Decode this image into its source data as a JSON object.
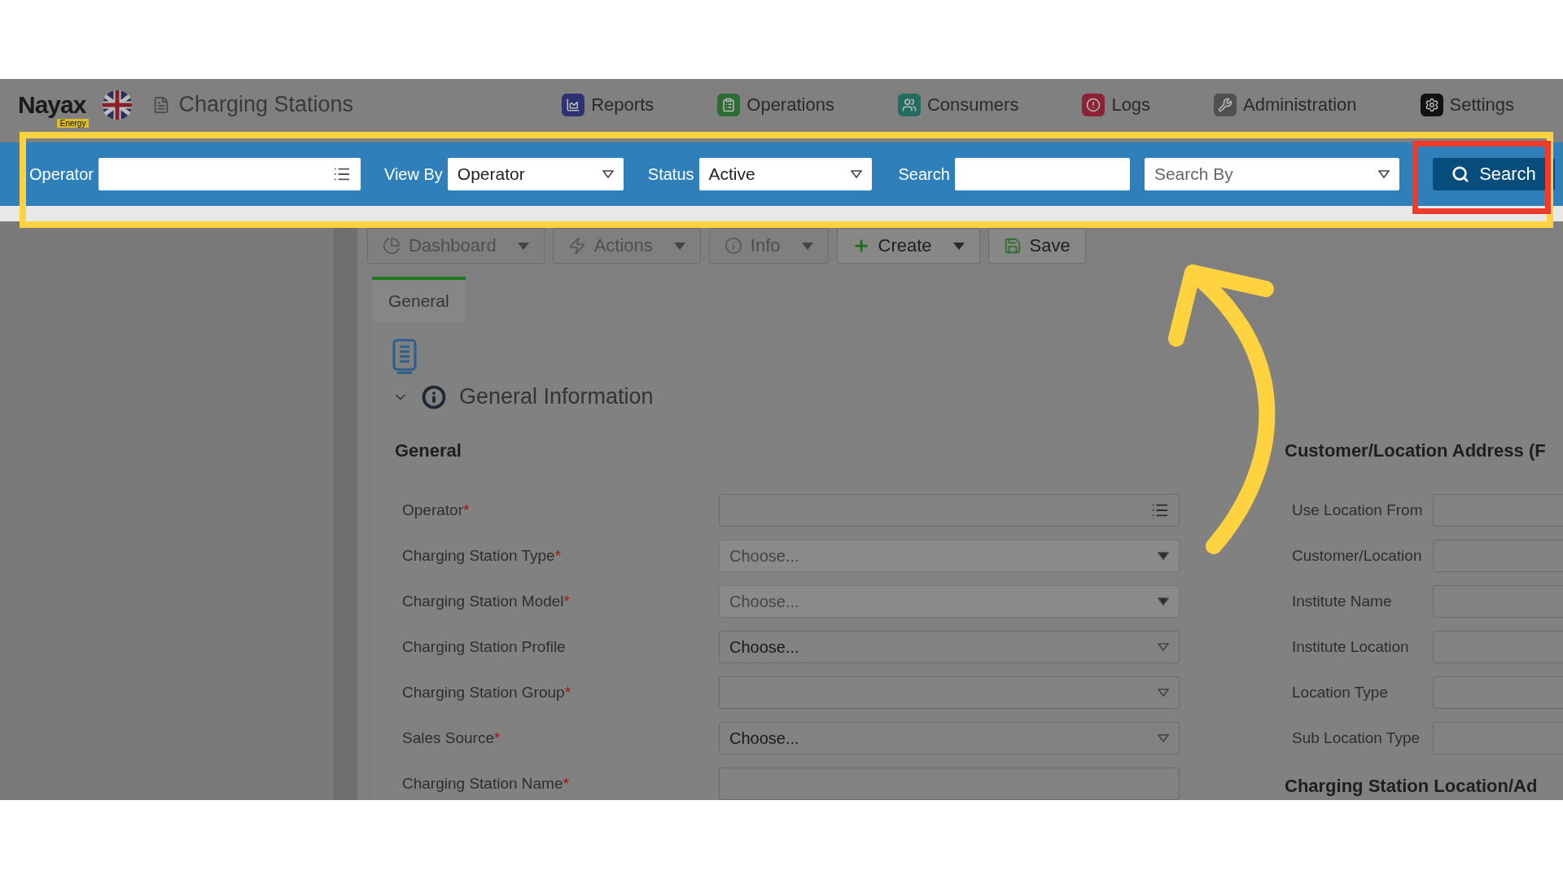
{
  "header": {
    "logo": "Nayax",
    "logo_badge": "Energy",
    "page_title": "Charging Stations",
    "menu": [
      {
        "label": "Reports"
      },
      {
        "label": "Operations"
      },
      {
        "label": "Consumers"
      },
      {
        "label": "Logs"
      },
      {
        "label": "Administration"
      },
      {
        "label": "Settings"
      }
    ]
  },
  "search_bar": {
    "fields": [
      {
        "kind": "lookup",
        "label": "Operator"
      },
      {
        "kind": "select",
        "label": "View By",
        "value": "Operator"
      },
      {
        "kind": "select",
        "label": "Status",
        "value": "Active"
      },
      {
        "kind": "text",
        "label": "Search"
      },
      {
        "kind": "select",
        "placeholder": "Search By"
      }
    ],
    "button": "Search"
  },
  "toolbar": [
    {
      "label": "Dashboard",
      "dropdown": true,
      "disabled": true
    },
    {
      "label": "Actions",
      "dropdown": true,
      "disabled": true
    },
    {
      "label": "Info",
      "dropdown": true,
      "disabled": true
    },
    {
      "label": "Create",
      "dropdown": true,
      "disabled": false
    },
    {
      "label": "Save",
      "dropdown": false,
      "disabled": false
    }
  ],
  "tabs": [
    {
      "label": "General",
      "selected": true
    }
  ],
  "section": {
    "title": "General Information",
    "expanded": true
  },
  "general": {
    "heading": "General",
    "rows": [
      {
        "label": "Operator",
        "required_mark": "*",
        "kind": "lookup"
      },
      {
        "label": "Charging Station Type",
        "required_mark": "*",
        "kind": "select",
        "placeholder": "Choose...",
        "disabled": true
      },
      {
        "label": "Charging Station Model",
        "required_mark": "*",
        "kind": "select",
        "placeholder": "Choose...",
        "disabled": true
      },
      {
        "label": "Charging Station Profile",
        "kind": "select",
        "value": "Choose...",
        "disabled": false
      },
      {
        "label": "Charging Station Group",
        "required_mark": "*",
        "kind": "select",
        "disabled": false
      },
      {
        "label": "Sales Source",
        "required_mark": "*",
        "kind": "select",
        "value": "Choose...",
        "disabled": false
      },
      {
        "label": "Charging Station Name",
        "required_mark": "*",
        "kind": "text"
      }
    ]
  },
  "address": {
    "heading": "Customer/Location Address (F",
    "rows": [
      {
        "label": "Use Location From"
      },
      {
        "label": "Customer/Location"
      },
      {
        "label": "Institute Name"
      },
      {
        "label": "Institute Location"
      },
      {
        "label": "Location Type"
      },
      {
        "label": "Sub Location Type"
      }
    ],
    "next_heading": "Charging Station Location/Ad"
  }
}
